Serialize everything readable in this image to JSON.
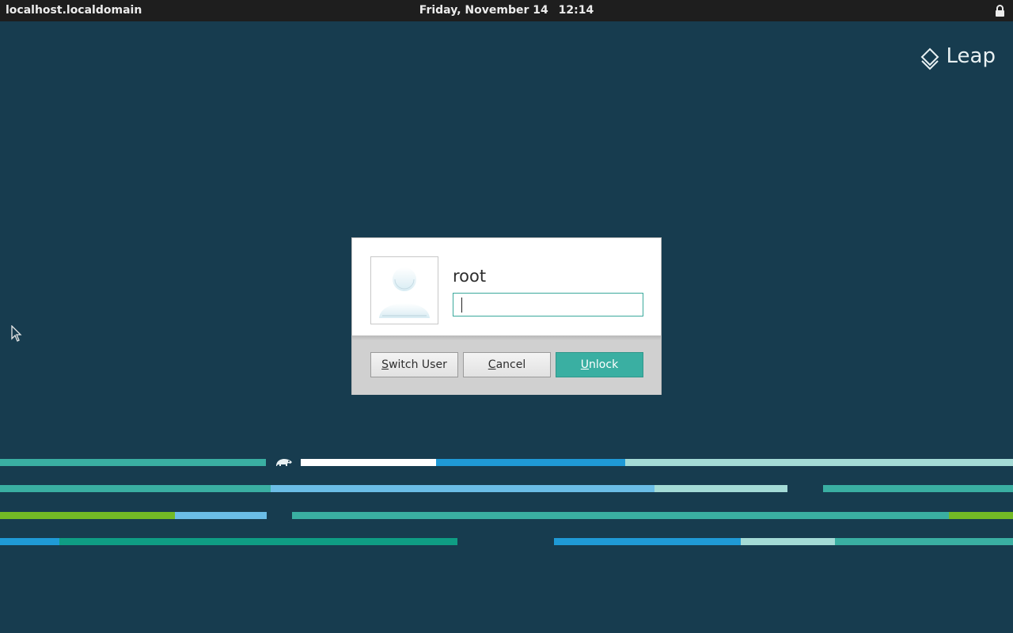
{
  "topbar": {
    "hostname": "localhost.localdomain",
    "date": "Friday, November 14",
    "time": "12:14",
    "lock_icon": "lock-icon"
  },
  "brand": {
    "label": "Leap",
    "icon": "leap-diamond-icon"
  },
  "dialog": {
    "username": "root",
    "password_value": "",
    "avatar_icon": "user-avatar-icon",
    "buttons": {
      "switch_user": {
        "mnemonic": "S",
        "rest": "witch User"
      },
      "cancel": {
        "mnemonic": "C",
        "rest": "ancel"
      },
      "unlock": {
        "mnemonic": "U",
        "rest": "nlock"
      }
    }
  },
  "colors": {
    "background": "#173c4f",
    "topbar": "#1e1e1e",
    "accent": "#3aafa2",
    "stripe_teal": "#3aafa2",
    "stripe_blue": "#1f9ad6",
    "stripe_light_blue": "#6bbde6",
    "stripe_pale": "#a4dbd6",
    "stripe_green": "#73ba25",
    "stripe_dark_teal": "#0f9d84",
    "stripe_white": "#ffffff"
  }
}
